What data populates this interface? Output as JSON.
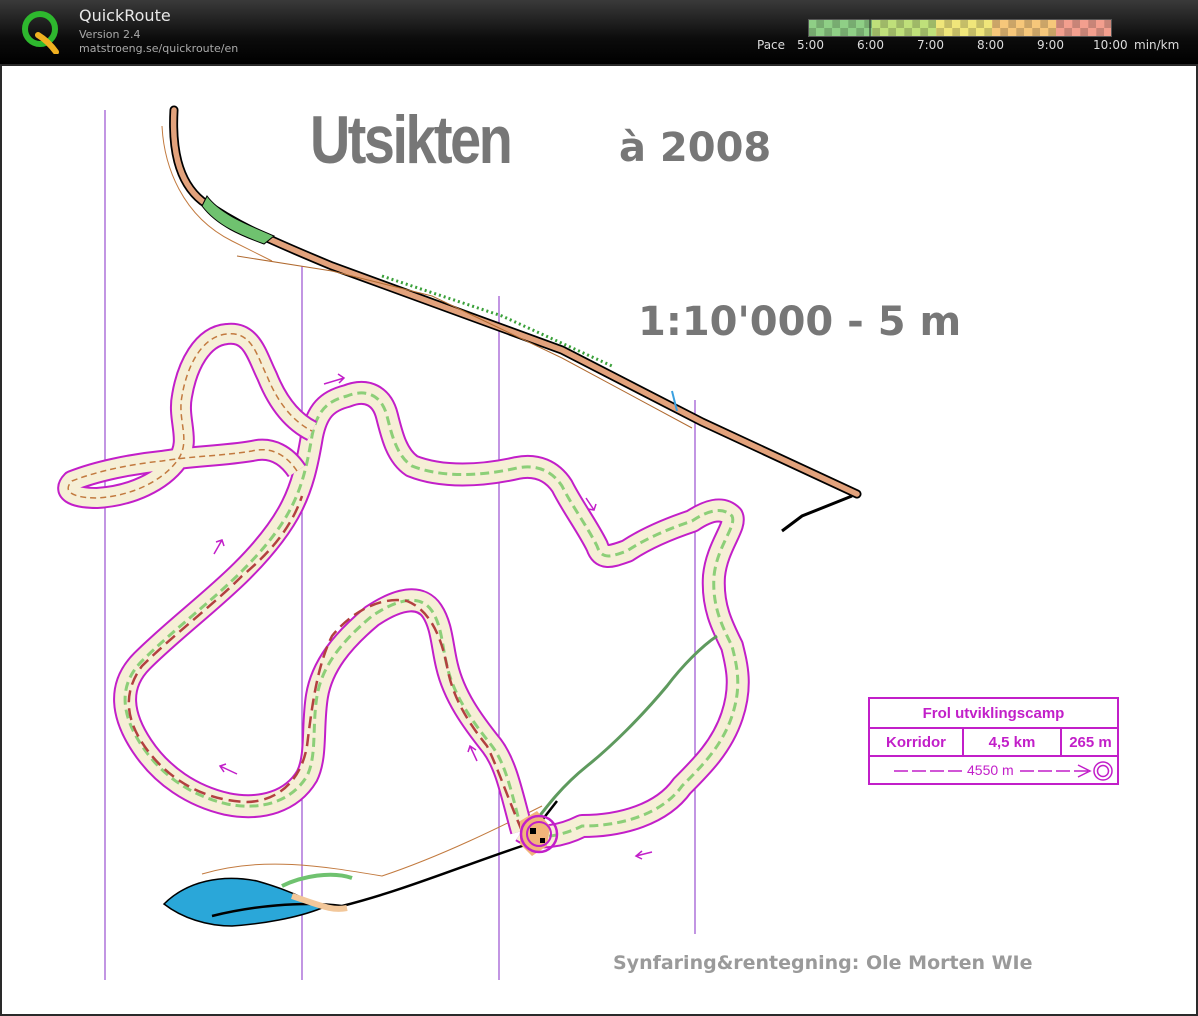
{
  "app": {
    "name": "QuickRoute",
    "version": "Version 2.4",
    "url": "matstroeng.se/quickroute/en"
  },
  "pace_scale": {
    "label": "Pace",
    "unit": "min/km",
    "ticks": [
      "5:00",
      "6:00",
      "7:00",
      "8:00",
      "9:00",
      "10:00"
    ],
    "colors": [
      "#8fcf86",
      "#bfe07a",
      "#f0e67a",
      "#f6c77a",
      "#f39f8e"
    ]
  },
  "map": {
    "title": "Utsikten",
    "year": "à 2008",
    "scale": "1:10'000 - 5 m",
    "credit": "Synfaring&rentegning: Ole Morten WIe",
    "course_color": "#c21fc9"
  },
  "course_box": {
    "event": "Frol utviklingscamp",
    "class": "Korridor",
    "length": "4,5 km",
    "climb": "265 m",
    "distance": "4550 m"
  }
}
